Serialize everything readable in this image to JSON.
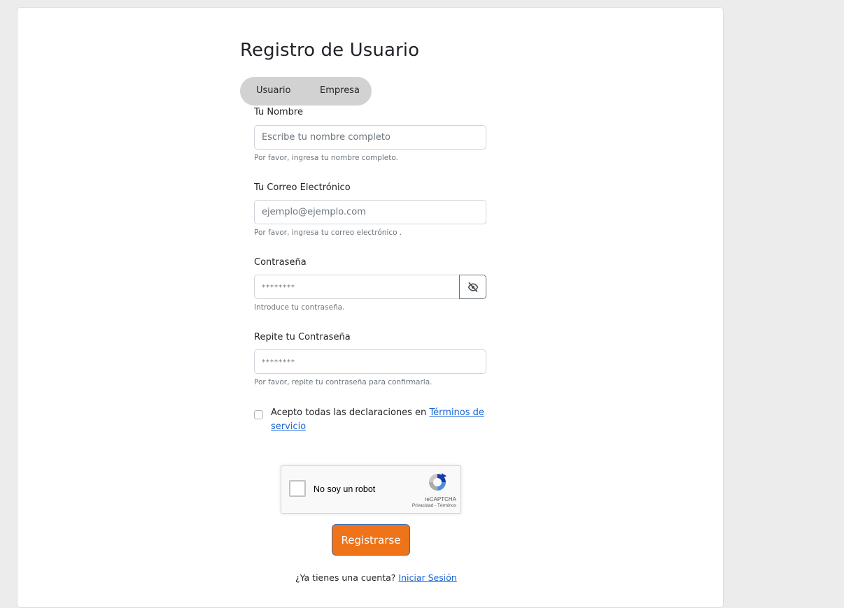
{
  "page": {
    "title": "Registro de Usuario"
  },
  "tabs": [
    {
      "label": "Usuario"
    },
    {
      "label": "Empresa"
    }
  ],
  "fields": {
    "name": {
      "label": "Tu Nombre",
      "placeholder": "Escribe tu nombre completo",
      "value": "",
      "help": "Por favor, ingresa tu nombre completo."
    },
    "email": {
      "label": "Tu Correo Electrónico",
      "placeholder": "ejemplo@ejemplo.com",
      "value": "",
      "help": "Por favor, ingresa tu correo electrónico ."
    },
    "password": {
      "label": "Contraseña",
      "placeholder": "********",
      "value": "",
      "help": "Introduce tu contraseña.",
      "toggle_icon": "eye-slash-icon"
    },
    "password_confirm": {
      "label": "Repite tu Contraseña",
      "placeholder": "********",
      "value": "",
      "help": "Por favor, repite tu contraseña para confirmarla."
    }
  },
  "terms": {
    "checked": false,
    "text": "Acepto todas las declaraciones en",
    "link_text": "Términos de servicio"
  },
  "recaptcha": {
    "label": "No soy un robot",
    "brand": "reCAPTCHA",
    "privacy": "Privacidad",
    "separator": " - ",
    "terms": "Términos"
  },
  "submit": {
    "label": "Registrarse"
  },
  "login": {
    "prompt": "¿Ya tienes una cuenta?",
    "link_text": "Iniciar Sesión"
  },
  "colors": {
    "page_background": "#ececec",
    "card_background": "#ffffff",
    "tab_background": "#d2d2d2",
    "submit_background": "#ef7318",
    "submit_border": "#3b6fb6",
    "link": "#1a66d6",
    "help_text": "#6c757d"
  }
}
